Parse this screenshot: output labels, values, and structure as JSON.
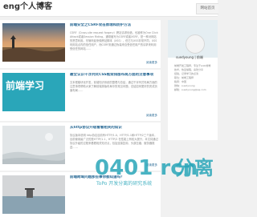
{
  "header": {
    "site_title": "eng个人博客",
    "nav_label": "网站首页"
  },
  "posts": [
    {
      "title": "前端安全之CSRF攻击原理和防护方法",
      "summary": "CSRF（Cross-site request forgery）跨站请求伪造，也被称为One Click Attack或者Session Riding，通常缩写为CSRF或者XSRF，是一种对网站的恶意利用。尽管听起来像跨站脚本（XSS），但它与XSS非常不同，XSS利用站点内的信任用户，而CSRF则通过伪装来自受信任用户的请求来利用受信任的网站……",
      "read_more": "阅读更多"
    },
    {
      "title": "最全认识干浮列式CSS框架排版布局方面的注意事项",
      "thumb_text": "前端学习",
      "summary": "文本框模块化开发，前端知识系统的整理与总结，通过干浮列式布局方面的注意事项帮助大家了解前端排版布局中的常见问题，总结如何更好的完成页面布局……",
      "read_more": "阅读更多"
    },
    {
      "title": "从http协议升级看看相关的知识",
      "summary": "协议版本说明 http协议目前有HTTP/1.0、HTTP/1.1和HTTP/2三个版本，目前使用最广泛的是HTTP/1.1，HTTP/2 在性能上有较大提升，本文将通过协议升级的过程来看看相关知识点，包括连接复用、头部压缩、服务器推送……",
      "read_more": "阅读更多"
    },
    {
      "title": "前端跨域问题那些事你都知道吗？",
      "summary": "",
      "read_more": ""
    }
  ],
  "sidebar": {
    "username": "suedyoung | 前端",
    "bio": [
      "前端开发工程师，专注于web前端",
      "技术，热爱编程，喜欢分享",
      "经验，记录学习的点滴",
      "职位：前端工程师",
      "籍贯：中国",
      "微信：suedyoung",
      "邮箱：suedyoung@qq.com"
    ]
  },
  "watermark": {
    "domain": "0401 rcn",
    "cn": "分离",
    "sub": "ToPo 开发分离的研究系统"
  },
  "colors": {
    "title_blue": "#2b6b96",
    "watermark_teal": "#2aa6b9"
  }
}
